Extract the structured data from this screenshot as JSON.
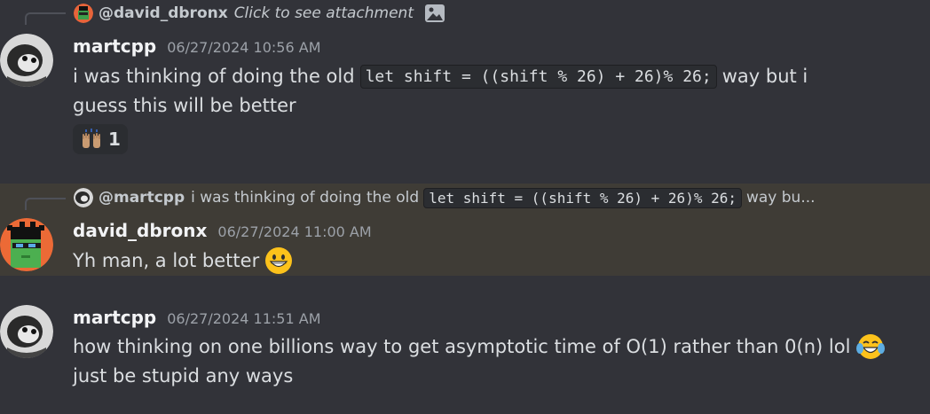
{
  "messages": [
    {
      "reply": {
        "author": "@david_dbronx",
        "text": "Click to see attachment",
        "icon": "image-icon"
      },
      "username": "martcpp",
      "timestamp": "06/27/2024 10:56 AM",
      "line1_prefix": "i was thinking of doing  the old",
      "line1_code": "let shift = ((shift % 26) + 26)% 26;",
      "line1_suffix": "way but i",
      "line2": "guess this will be better",
      "reaction": {
        "emoji": "raising-hands-emoji",
        "count": "1"
      }
    },
    {
      "reply": {
        "author": "@martcpp",
        "text_prefix": "i was thinking of doing  the old",
        "code": "let shift = ((shift % 26) + 26)% 26;",
        "text_suffix": "way bu..."
      },
      "username": "david_dbronx",
      "timestamp": "06/27/2024 11:00 AM",
      "line1": "Yh man, a lot better",
      "emoji": "grinning-face-emoji"
    },
    {
      "username": "martcpp",
      "timestamp": "06/27/2024 11:51 AM",
      "line1": "how thinking on one billions way to get asymptotic time of O(1) rather than 0(n) lol",
      "emoji": "tears-of-joy-emoji",
      "line2": "just be stupid any ways"
    }
  ],
  "colors": {
    "background": "#323339",
    "highlight": "#3f3c36",
    "username": "#f2f3f5",
    "timestamp": "#9ca1a8",
    "text": "#dbdee1"
  }
}
